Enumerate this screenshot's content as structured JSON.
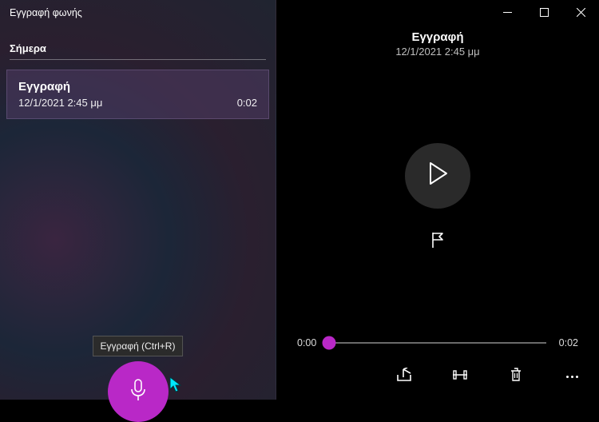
{
  "app": {
    "title": "Εγγραφή φωνής"
  },
  "sidebar": {
    "section_label": "Σήμερα",
    "items": [
      {
        "title": "Εγγραφή",
        "date": "12/1/2021 2:45 μμ",
        "duration": "0:02"
      }
    ],
    "record_tooltip": "Εγγραφή (Ctrl+R)"
  },
  "detail": {
    "title": "Εγγραφή",
    "date": "12/1/2021 2:45 μμ",
    "time_current": "0:00",
    "time_total": "0:02"
  },
  "colors": {
    "accent": "#b928c7"
  }
}
